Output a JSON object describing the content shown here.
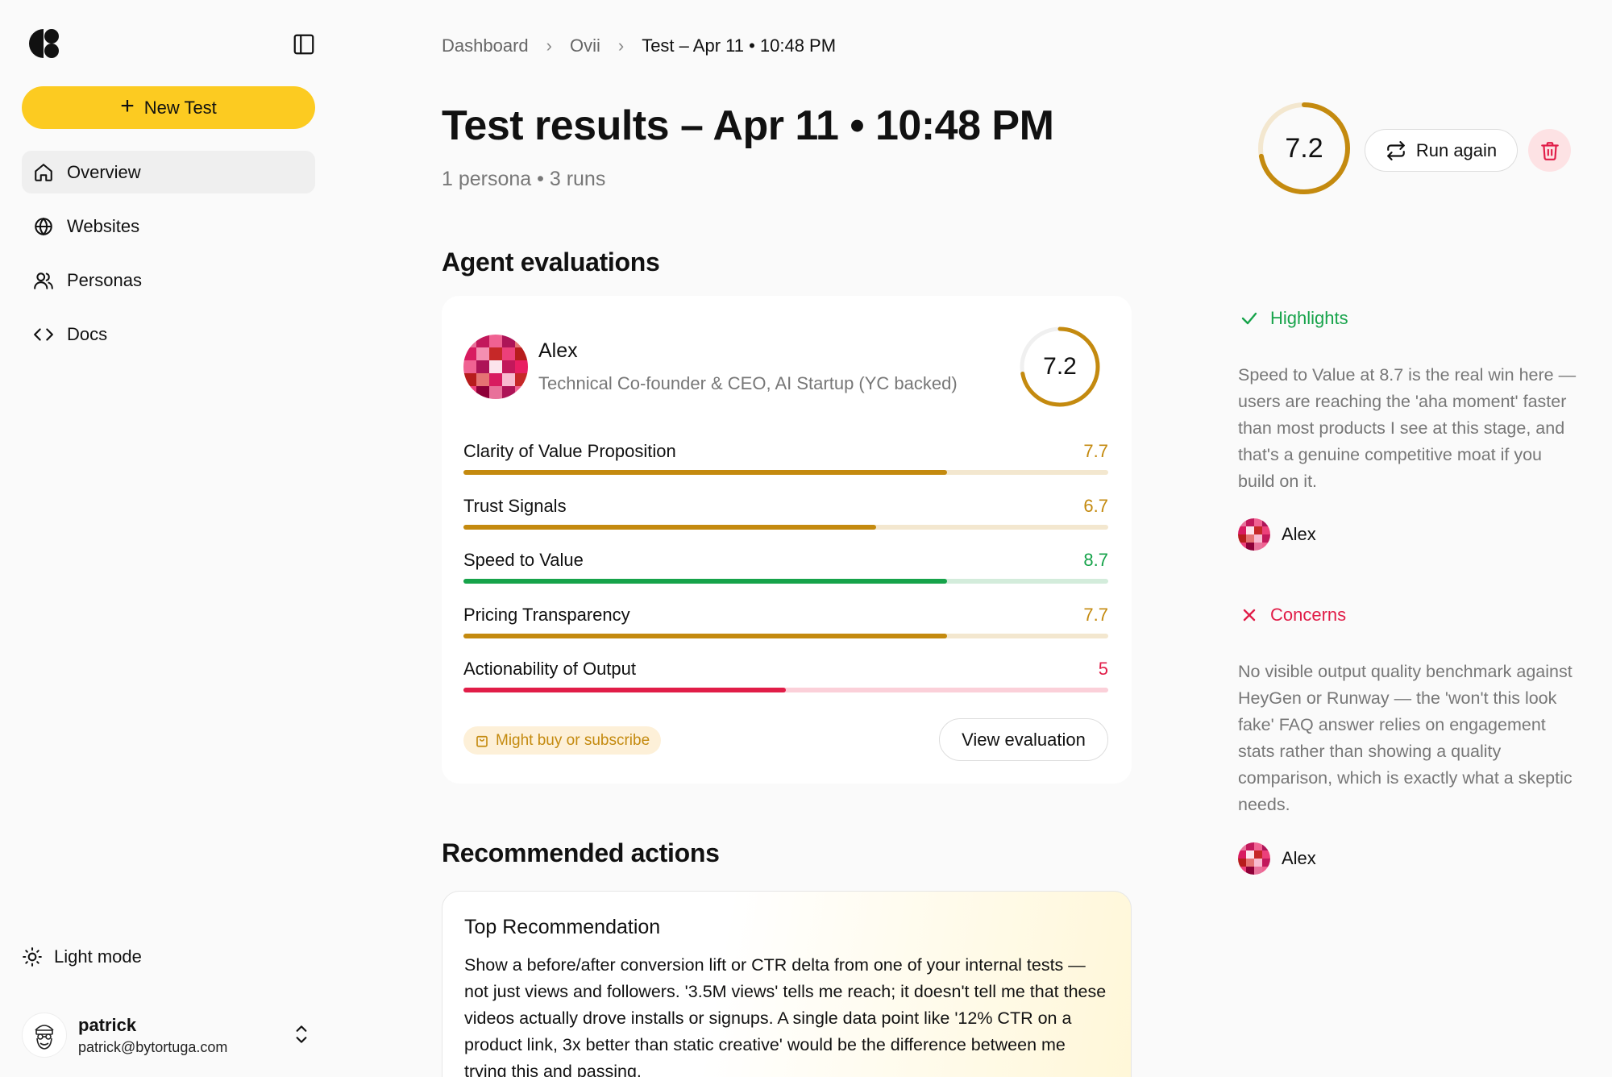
{
  "colors": {
    "accent_yellow": "#fccb21",
    "score_gold": "#c48a0f",
    "score_green": "#16a34a",
    "score_red": "#e11d48",
    "track_gold": "#f3e7cf",
    "track_green": "#d3ecdb",
    "track_red": "#fbd0d9"
  },
  "sidebar": {
    "new_test_label": "New Test",
    "items": [
      {
        "label": "Overview",
        "icon": "home-icon"
      },
      {
        "label": "Websites",
        "icon": "globe-icon"
      },
      {
        "label": "Personas",
        "icon": "users-icon"
      },
      {
        "label": "Docs",
        "icon": "code-icon"
      }
    ],
    "light_mode_label": "Light mode",
    "user": {
      "name": "patrick",
      "email": "patrick@bytortuga.com"
    }
  },
  "breadcrumb": [
    "Dashboard",
    "Ovii",
    "Test – Apr 11 • 10:48 PM"
  ],
  "header": {
    "title": "Test results – Apr 11 • 10:48 PM",
    "subtitle": "1 persona • 3 runs",
    "overall_score": "7.2",
    "overall_score_fraction": 0.72,
    "run_again_label": "Run again"
  },
  "agent_section": {
    "title": "Agent evaluations",
    "agent": {
      "name": "Alex",
      "role": "Technical Co-founder & CEO, AI Startup (YC backed)",
      "score": "7.2",
      "score_fraction": 0.72
    },
    "metrics": [
      {
        "label": "Clarity of Value Proposition",
        "score": "7.7",
        "fraction": 0.75,
        "tone": "gold"
      },
      {
        "label": "Trust Signals",
        "score": "6.7",
        "fraction": 0.64,
        "tone": "gold"
      },
      {
        "label": "Speed to Value",
        "score": "8.7",
        "fraction": 0.75,
        "tone": "green"
      },
      {
        "label": "Pricing Transparency",
        "score": "7.7",
        "fraction": 0.75,
        "tone": "gold"
      },
      {
        "label": "Actionability of Output",
        "score": "5",
        "fraction": 0.5,
        "tone": "red"
      }
    ],
    "badge": "Might buy or subscribe",
    "view_label": "View evaluation"
  },
  "recommend_section": {
    "title": "Recommended actions",
    "card_title": "Top Recommendation",
    "body": "Show a before/after conversion lift or CTR delta from one of your internal tests — not just views and followers. '3.5M views' tells me reach; it doesn't tell me that these videos actually drove installs or signups. A single data point like '12% CTR on a product link, 3x better than static creative' would be the difference between me trying this and passing."
  },
  "highlights": {
    "title": "Highlights",
    "text": "Speed to Value at 8.7 is the real win here — users are reaching the 'aha moment' faster than most products I see at this stage, and that's a genuine competitive moat if you build on it.",
    "author": "Alex"
  },
  "concerns": {
    "title": "Concerns",
    "text": "No visible output quality benchmark against HeyGen or Runway — the 'won't this look fake' FAQ answer relies on engagement stats rather than showing a quality comparison, which is exactly what a skeptic needs.",
    "author": "Alex"
  }
}
